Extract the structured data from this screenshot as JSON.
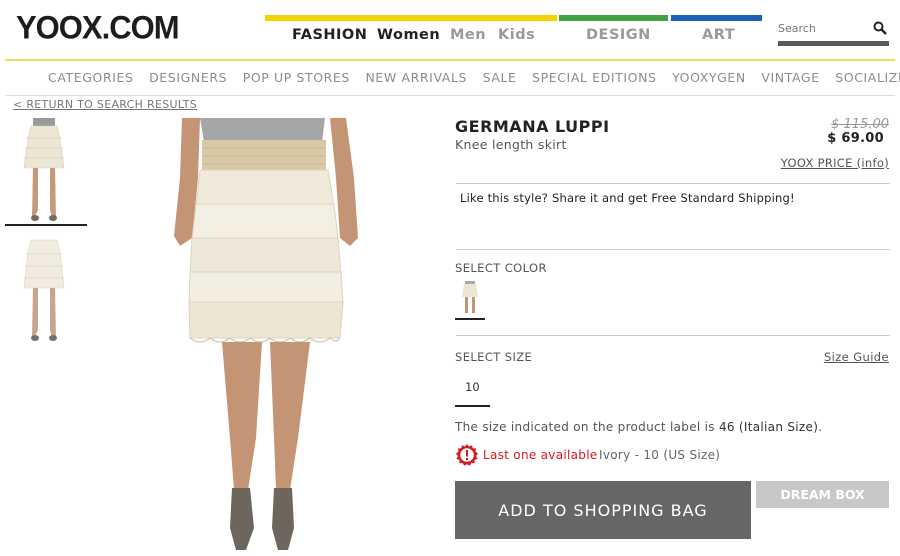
{
  "header": {
    "logo": "YOOX.COM",
    "nav": {
      "fashion": "FASHION",
      "women": "Women",
      "men": "Men",
      "kids": "Kids",
      "design": "DESIGN",
      "art": "ART"
    },
    "search": {
      "placeholder": "Search",
      "icon": "search-icon"
    },
    "colors": {
      "fashion": "#f2d500",
      "design": "#41a040",
      "art": "#1f62b8"
    }
  },
  "subnav": {
    "items": [
      "CATEGORIES",
      "DESIGNERS",
      "POP UP STORES",
      "NEW ARRIVALS",
      "SALE",
      "SPECIAL EDITIONS",
      "YOOXYGEN",
      "VINTAGE",
      "SOCIALIZE"
    ]
  },
  "return_link": "< RETURN TO SEARCH RESULTS",
  "product": {
    "brand": "GERMANA LUPPI",
    "subtitle": "Knee length skirt",
    "old_price": "$ 115.00",
    "new_price": "$ 69.00",
    "yoox_price_label": "YOOX PRICE (info)",
    "share_text": "Like this style? Share it and get Free Standard Shipping!",
    "select_color_label": "SELECT COLOR",
    "select_size_label": "SELECT SIZE",
    "size_guide_label": "Size Guide",
    "size_value": "10",
    "size_note_prefix": "The size indicated on the product label is ",
    "size_note_value": "46 (Italian Size)",
    "size_note_suffix": ".",
    "last_one_label": "Last one available",
    "variant_label": "Ivory - 10 (US Size)",
    "add_to_bag_label": "ADD TO SHOPPING BAG",
    "dream_box_label": "DREAM BOX"
  }
}
